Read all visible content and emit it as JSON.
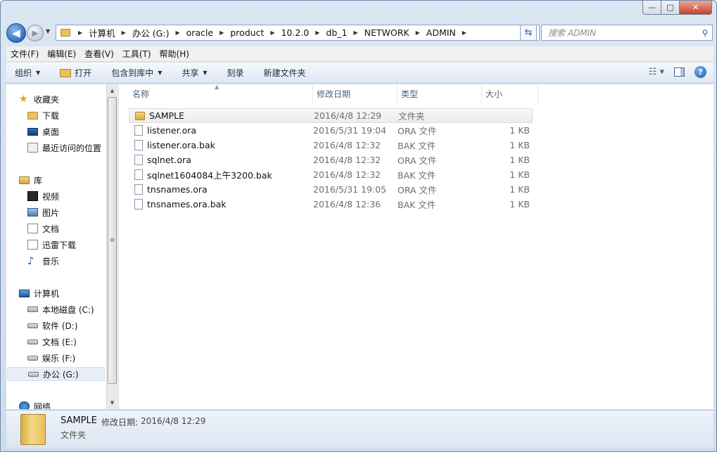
{
  "window": {
    "minimize_label": "—",
    "maximize_label": "□",
    "close_label": "✕"
  },
  "address_bar": {
    "crumbs": [
      "计算机",
      "办公 (G:)",
      "oracle",
      "product",
      "10.2.0",
      "db_1",
      "NETWORK",
      "ADMIN"
    ],
    "refresh_glyph": "⇆"
  },
  "search": {
    "placeholder": "搜索 ADMIN"
  },
  "menu": [
    "文件(F)",
    "编辑(E)",
    "查看(V)",
    "工具(T)",
    "帮助(H)"
  ],
  "toolbar": {
    "organize": "组织",
    "open": "打开",
    "include_in_library": "包含到库中",
    "share": "共享",
    "burn": "刻录",
    "new_folder": "新建文件夹"
  },
  "nav": {
    "favorites": "收藏夹",
    "downloads": "下载",
    "desktop": "桌面",
    "recent": "最近访问的位置",
    "libraries": "库",
    "videos": "视频",
    "pictures": "图片",
    "documents": "文档",
    "xunlei": "迅雷下载",
    "music": "音乐",
    "computer": "计算机",
    "drive_c": "本地磁盘 (C:)",
    "drive_d": "软件 (D:)",
    "drive_e": "文档 (E:)",
    "drive_f": "娱乐 (F:)",
    "drive_g": "办公 (G:)",
    "network": "网络"
  },
  "columns": {
    "name": "名称",
    "date": "修改日期",
    "type": "类型",
    "size": "大小"
  },
  "files": [
    {
      "name": "SAMPLE",
      "date": "2016/4/8 12:29",
      "type": "文件夹",
      "size": "",
      "icon": "folder-icon"
    },
    {
      "name": "listener.ora",
      "date": "2016/5/31 19:04",
      "type": "ORA 文件",
      "size": "1 KB",
      "icon": "file-icon"
    },
    {
      "name": "listener.ora.bak",
      "date": "2016/4/8 12:32",
      "type": "BAK 文件",
      "size": "1 KB",
      "icon": "file-icon"
    },
    {
      "name": "sqlnet.ora",
      "date": "2016/4/8 12:32",
      "type": "ORA 文件",
      "size": "1 KB",
      "icon": "file-icon"
    },
    {
      "name": "sqlnet1604084上午3200.bak",
      "date": "2016/4/8 12:32",
      "type": "BAK 文件",
      "size": "1 KB",
      "icon": "file-icon"
    },
    {
      "name": "tnsnames.ora",
      "date": "2016/5/31 19:05",
      "type": "ORA 文件",
      "size": "1 KB",
      "icon": "file-icon"
    },
    {
      "name": "tnsnames.ora.bak",
      "date": "2016/4/8 12:36",
      "type": "BAK 文件",
      "size": "1 KB",
      "icon": "file-icon"
    }
  ],
  "details": {
    "name": "SAMPLE",
    "date_label": "修改日期:",
    "date_value": "2016/4/8 12:29",
    "type": "文件夹"
  }
}
